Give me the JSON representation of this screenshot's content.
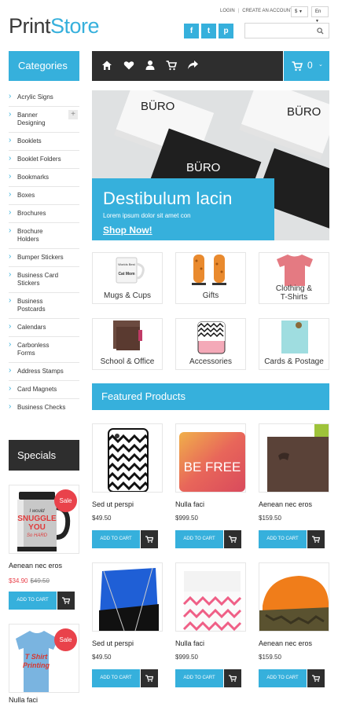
{
  "header": {
    "logo_part1": "Print",
    "logo_part2": "Store",
    "login": "LOGIN",
    "separator": "|",
    "create_account": "CREATE AN ACCOUNT",
    "currency": "$",
    "language": "En",
    "social": [
      "f",
      "t",
      "p"
    ],
    "search_placeholder": ""
  },
  "sidebar": {
    "categories_title": "Categories",
    "categories": [
      "Acrylic Signs",
      "Banner Designing",
      "Booklets",
      "Booklet Folders",
      "Bookmarks",
      "Boxes",
      "Brochures",
      "Brochure Holders",
      "Bumper Stickers",
      "Business Card Stickers",
      "Business Postcards",
      "Calendars",
      "Carbonless Forms",
      "Address Stamps",
      "Card Magnets",
      "Business Checks"
    ],
    "expand_symbol": "+",
    "specials_title": "Specials",
    "specials": [
      {
        "name": "Aenean nec eros",
        "price_new": "$34.90",
        "price_old": "$49.50",
        "badge": "Sale",
        "button": "ADD TO CART"
      },
      {
        "name": "Nulla faci",
        "badge": "Sale"
      }
    ]
  },
  "nav": {
    "icons": [
      "home-icon",
      "heart-icon",
      "user-icon",
      "cart-icon",
      "share-icon"
    ],
    "cart_count": "0"
  },
  "banner": {
    "title": "Destibulum lacin",
    "subtitle": "Lorem ipsum dolor sit amet con",
    "cta": "Shop Now!",
    "card_brand": "BÜRO"
  },
  "category_tiles": [
    {
      "label": "Mugs & Cups"
    },
    {
      "label": "Gifts"
    },
    {
      "label": "Clothing &\nT-Shirts"
    },
    {
      "label": "School & Office"
    },
    {
      "label": "Accessories"
    },
    {
      "label": "Cards & Postage"
    }
  ],
  "featured": {
    "title": "Featured Products",
    "products": [
      {
        "name": "Sed ut perspi",
        "price": "$49.50",
        "button": "ADD TO CART"
      },
      {
        "name": "Nulla faci",
        "price": "$999.50",
        "button": "ADD TO CART"
      },
      {
        "name": "Aenean nec eros",
        "price": "$159.50",
        "button": "ADD TO CART"
      },
      {
        "name": "Sed ut perspi",
        "price": "$49.50",
        "button": "ADD TO CART"
      },
      {
        "name": "Nulla faci",
        "price": "$999.50",
        "button": "ADD TO CART"
      },
      {
        "name": "Aenean nec eros",
        "price": "$159.50",
        "button": "ADD TO CART"
      }
    ],
    "image_texts": [
      "BE FREE"
    ]
  },
  "special_image_texts": [
    "I would SNUGGLE YOU So HARD",
    "T Shirt Printing"
  ],
  "mug_image_text": "Worlds Best Cat Mom",
  "colors": {
    "accent": "#36b0dc",
    "dark": "#2e2e2e",
    "sale": "#e9424b"
  }
}
